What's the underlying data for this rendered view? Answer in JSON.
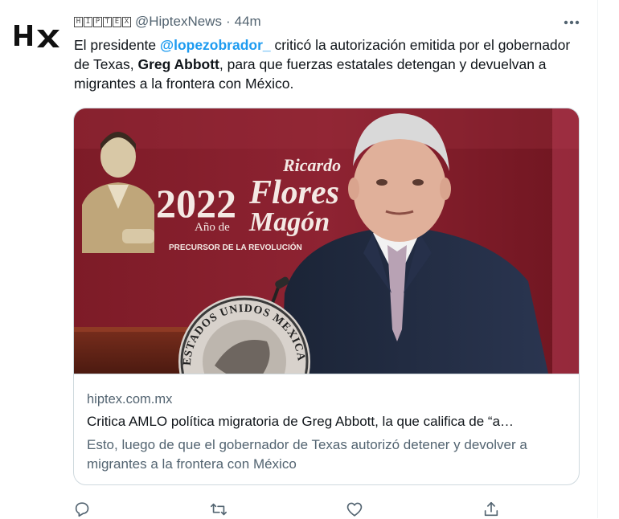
{
  "account": {
    "avatar_text": "Hx",
    "display_name_boxes": [
      "H",
      "I",
      "P",
      "T",
      "E",
      "X"
    ],
    "handle": "@HiptexNews",
    "separator": "·",
    "time": "44m"
  },
  "tweet": {
    "text_1": "El presidente ",
    "mention": "@lopezobrador_",
    "text_2": " criticó la autorización emitida por el gobernador de Texas, ",
    "bold": "Greg Abbott",
    "text_3": ", para que fuerzas estatales detengan y devuelvan a migrantes a la frontera con México."
  },
  "card_image": {
    "year": "2022",
    "ano_de": "Año de",
    "name_1": "Ricardo",
    "name_2": "Flores",
    "name_3": "Magón",
    "subtitle": "PRECURSOR DE LA REVOLUCIÓN",
    "seal_text": "ESTADOS UNIDOS MEXICANOS"
  },
  "card": {
    "domain": "hiptex.com.mx",
    "title": "Critica AMLO política migratoria de Greg Abbott, la que califica de “a…",
    "description": "Esto, luego de que el gobernador de Texas autorizó detener y devolver a migrantes a la frontera con México"
  },
  "icons": {
    "more": "more-icon",
    "reply": "reply-icon",
    "retweet": "retweet-icon",
    "like": "like-icon",
    "share": "share-icon"
  },
  "colors": {
    "accent": "#1d9bf0",
    "secondary_text": "#536471",
    "border": "#cfd9de",
    "banner_red": "#8c1f2c"
  }
}
